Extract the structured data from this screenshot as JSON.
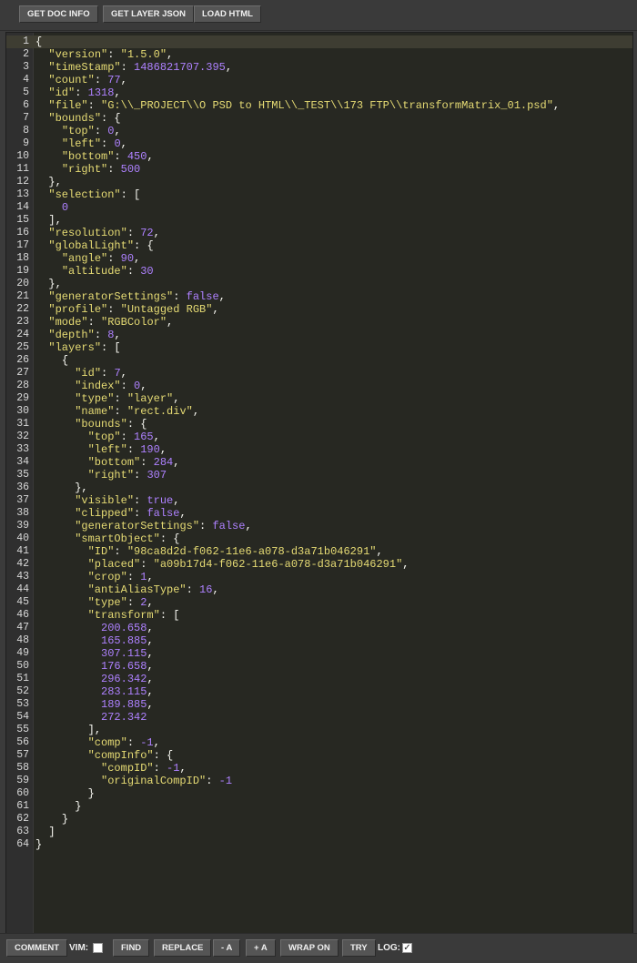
{
  "toolbar": {
    "buttons": [
      "GET DOC INFO",
      "GET LAYER JSON",
      "LOAD HTML"
    ]
  },
  "editor": {
    "theme_colors": {
      "background": "#272822",
      "key": "#e6db74",
      "string": "#e6db74",
      "number": "#ae81ff"
    },
    "lines": [
      "{",
      "  \"version\": \"1.5.0\",",
      "  \"timeStamp\": 1486821707.395,",
      "  \"count\": 77,",
      "  \"id\": 1318,",
      "  \"file\": \"G:\\\\_PROJECT\\\\O PSD to HTML\\\\_TEST\\\\173 FTP\\\\transformMatrix_01.psd\",",
      "  \"bounds\": {",
      "    \"top\": 0,",
      "    \"left\": 0,",
      "    \"bottom\": 450,",
      "    \"right\": 500",
      "  },",
      "  \"selection\": [",
      "    0",
      "  ],",
      "  \"resolution\": 72,",
      "  \"globalLight\": {",
      "    \"angle\": 90,",
      "    \"altitude\": 30",
      "  },",
      "  \"generatorSettings\": false,",
      "  \"profile\": \"Untagged RGB\",",
      "  \"mode\": \"RGBColor\",",
      "  \"depth\": 8,",
      "  \"layers\": [",
      "    {",
      "      \"id\": 7,",
      "      \"index\": 0,",
      "      \"type\": \"layer\",",
      "      \"name\": \"rect.div\",",
      "      \"bounds\": {",
      "        \"top\": 165,",
      "        \"left\": 190,",
      "        \"bottom\": 284,",
      "        \"right\": 307",
      "      },",
      "      \"visible\": true,",
      "      \"clipped\": false,",
      "      \"generatorSettings\": false,",
      "      \"smartObject\": {",
      "        \"ID\": \"98ca8d2d-f062-11e6-a078-d3a71b046291\",",
      "        \"placed\": \"a09b17d4-f062-11e6-a078-d3a71b046291\",",
      "        \"crop\": 1,",
      "        \"antiAliasType\": 16,",
      "        \"type\": 2,",
      "        \"transform\": [",
      "          200.658,",
      "          165.885,",
      "          307.115,",
      "          176.658,",
      "          296.342,",
      "          283.115,",
      "          189.885,",
      "          272.342",
      "        ],",
      "        \"comp\": -1,",
      "        \"compInfo\": {",
      "          \"compID\": -1,",
      "          \"originalCompID\": -1",
      "        }",
      "      }",
      "    }",
      "  ]",
      "}"
    ]
  },
  "footer": {
    "comment_label": "COMMENT",
    "vim_label": "VIM:",
    "vim_checked": false,
    "find_label": "FIND",
    "replace_label": "REPLACE",
    "font_down_label": "- A",
    "font_up_label": "+ A",
    "wrap_label": "WRAP ON",
    "try_label": "TRY",
    "log_label": "LOG:",
    "log_checked": true
  }
}
